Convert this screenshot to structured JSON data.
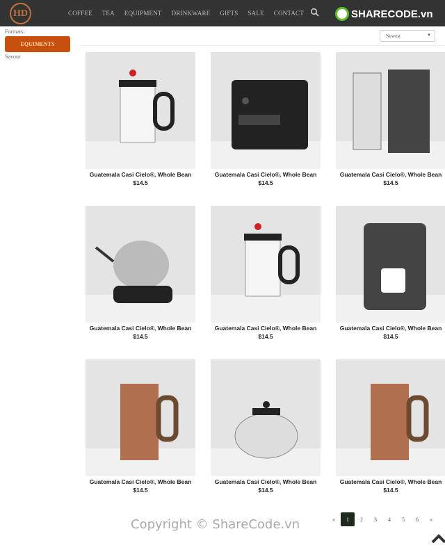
{
  "header": {
    "logo_text": "HD",
    "nav": [
      "COFFEE",
      "TEA",
      "EQUIPMENT",
      "DRINKWARE",
      "GIFTS",
      "SALE",
      "CONTACT"
    ],
    "watermark": "SHARECODE.vn"
  },
  "sidebar": {
    "formats_label": "Formats:",
    "active_button": "EQUIMENTS",
    "savour_label": "Savour"
  },
  "sort": {
    "selected": "Newest"
  },
  "products": [
    {
      "name": "Guatemala Casi Cielo®, Whole Bean",
      "price": "$14.5",
      "kind": "french-press"
    },
    {
      "name": "Guatemala Casi Cielo®, Whole Bean",
      "price": "$14.5",
      "kind": "espresso-machine"
    },
    {
      "name": "Guatemala Casi Cielo®, Whole Bean",
      "price": "$14.5",
      "kind": "brewer"
    },
    {
      "name": "Guatemala Casi Cielo®, Whole Bean",
      "price": "$14.5",
      "kind": "kettle"
    },
    {
      "name": "Guatemala Casi Cielo®, Whole Bean",
      "price": "$14.5",
      "kind": "french-press"
    },
    {
      "name": "Guatemala Casi Cielo®, Whole Bean",
      "price": "$14.5",
      "kind": "keurig"
    },
    {
      "name": "Guatemala Casi Cielo®, Whole Bean",
      "price": "$14.5",
      "kind": "copper-press"
    },
    {
      "name": "Guatemala Casi Cielo®, Whole Bean",
      "price": "$14.5",
      "kind": "teapot"
    },
    {
      "name": "Guatemala Casi Cielo®, Whole Bean",
      "price": "$14.5",
      "kind": "copper-press"
    }
  ],
  "pagination": {
    "prev": "«",
    "pages": [
      "1",
      "2",
      "3",
      "4",
      "5",
      "6"
    ],
    "active": "1",
    "next": "»"
  },
  "footer": {
    "copyright": "Copyright © ShareCode.vn"
  }
}
